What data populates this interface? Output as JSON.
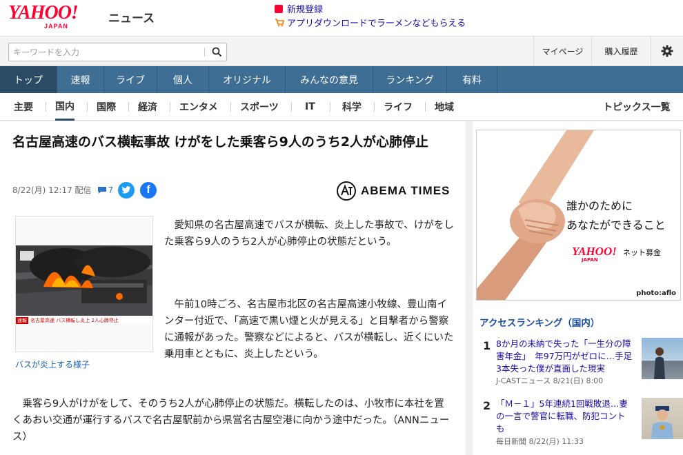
{
  "header": {
    "logo_main": "YAHOO!",
    "logo_sub": "JAPAN",
    "service_name": "ニュース",
    "promo_1": "新規登録",
    "promo_2": "アプリダウンロードでラーメンなどもらえる",
    "search_placeholder": "キーワードを入力",
    "mypage": "マイページ",
    "history": "購入履歴"
  },
  "main_nav": [
    "トップ",
    "速報",
    "ライブ",
    "個人",
    "オリジナル",
    "みんなの意見",
    "ランキング",
    "有料"
  ],
  "main_nav_active": "トップ",
  "sub_nav": [
    "主要",
    "国内",
    "国際",
    "経済",
    "エンタメ",
    "スポーツ",
    "IT",
    "科学",
    "ライフ",
    "地域"
  ],
  "sub_nav_active": "国内",
  "sub_nav_right": "トピックス一覧",
  "article": {
    "headline": "名古屋高速のバス横転事故 けがをした乗客ら9人のうち2人が心肺停止",
    "datetime": "8/22(月) 12:17 配信",
    "comments": "7",
    "publisher": "ABEMA TIMES",
    "photo_ticker": "名古屋高速 バス横転し炎上 2人心肺停止",
    "photo_caption": "バスが炎上する様子",
    "paragraphs": [
      "愛知県の名古屋高速でバスが横転、炎上した事故で、けがをした乗客ら9人のうち2人が心肺停止の状態だという。",
      "午前10時ごろ、名古屋市北区の名古屋高速小牧線、豊山南インター付近で、「高速で黒い煙と火が見える」と目撃者から警察に通報があった。警察などによると、バスが横転し、近くにいた乗用車とともに、炎上したという。",
      "乗客ら9人がけがをして、そのうち2人が心肺停止の状態だ。横転したのは、小牧市に本社を置くあおい交通が運行するバスで名古屋駅前から県営名古屋空港に向かう途中だった。（ANNニュース）"
    ]
  },
  "ad": {
    "line1": "誰かのために",
    "line2": "あなたができること",
    "brand": "YAHOO!",
    "brand_sub": "JAPAN",
    "brand_suffix": "ネット募金",
    "credit": "photo:aflo"
  },
  "ranking": {
    "title": "アクセスランキング（国内）",
    "items": [
      {
        "rank": "1",
        "title": "8か月の未納で失った「一生分の障害年金」　年97万円がゼロに…手足3本失った僕が直面した現実",
        "source": "J-CASTニュース 8/21(日) 8:00"
      },
      {
        "rank": "2",
        "title": "「Ｍ－１」5年連続1回戦敗退…妻の一言で警官に転職、防犯コント も",
        "source": "毎日新聞 8/22(月) 11:33"
      }
    ]
  },
  "colors": {
    "brand_red": "#ff0033",
    "nav_blue": "#3f6e94",
    "nav_active": "#2b4a66",
    "link_blue": "#1a0dab"
  }
}
